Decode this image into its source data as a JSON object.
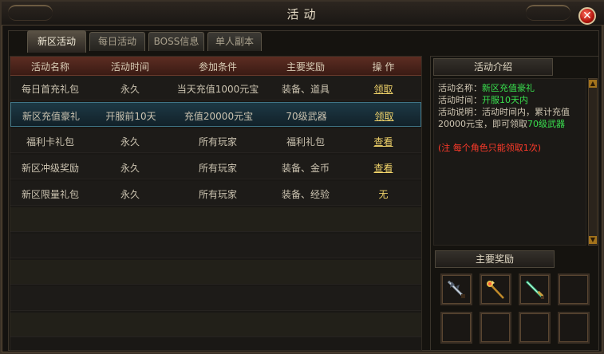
{
  "window": {
    "title": "活动"
  },
  "tabs": [
    {
      "label": "新区活动"
    },
    {
      "label": "每日活动"
    },
    {
      "label": "BOSS信息"
    },
    {
      "label": "单人副本"
    }
  ],
  "table": {
    "headers": [
      "活动名称",
      "活动时间",
      "参加条件",
      "主要奖励",
      "操  作"
    ],
    "rows": [
      {
        "name": "每日首充礼包",
        "time": "永久",
        "condition": "当天充值1000元宝",
        "reward": "装备、道具",
        "action": "领取"
      },
      {
        "name": "新区充值豪礼",
        "time": "开服前10天",
        "condition": "充值20000元宝",
        "reward": "70级武器",
        "action": "领取"
      },
      {
        "name": "福利卡礼包",
        "time": "永久",
        "condition": "所有玩家",
        "reward": "福利礼包",
        "action": "查看"
      },
      {
        "name": "新区冲级奖励",
        "time": "永久",
        "condition": "所有玩家",
        "reward": "装备、金币",
        "action": "查看"
      },
      {
        "name": "新区限量礼包",
        "time": "永久",
        "condition": "所有玩家",
        "reward": "装备、经验",
        "action": "无"
      }
    ]
  },
  "intro": {
    "header": "活动介绍",
    "name_label": "活动名称：",
    "name_value": "新区充值豪礼",
    "time_label": "活动时间：",
    "time_value": "开服10天内",
    "desc_prefix": "活动说明：活动时间内，累计充值20000元宝，即可领取",
    "desc_highlight": "70级武器",
    "note": "(注 每个角色只能领取1次)"
  },
  "rewards": {
    "header": "主要奖励",
    "items": [
      "dark-sword-icon",
      "golden-staff-icon",
      "jade-sword-icon",
      "empty",
      "empty",
      "empty",
      "empty",
      "empty"
    ]
  },
  "colors": {
    "highlight_green": "#39e04e",
    "note_red": "#ff3a2a",
    "action_gold": "#f0d36a"
  }
}
